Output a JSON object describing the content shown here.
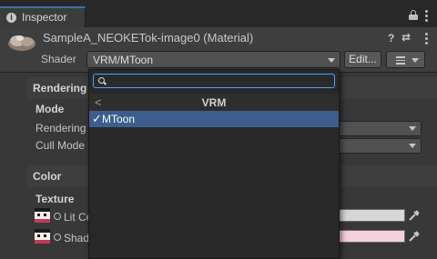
{
  "tab": {
    "icon": "info-icon",
    "label": "Inspector"
  },
  "header": {
    "title": "SampleA_NEOKETok-image0 (Material)",
    "help_icon": "?",
    "settings_icon": "⇄",
    "shader_label": "Shader",
    "shader_value": "VRM/MToon",
    "edit_label": "Edit...",
    "icons": [
      "lock-icon",
      "kebab-icon",
      "help-icon",
      "preset-icon",
      "list-icon"
    ]
  },
  "sections": {
    "rendering": "Rendering",
    "mode": "Mode",
    "rendering_row": "Rendering",
    "cull_mode_row": "Cull Mode",
    "color": "Color",
    "texture": "Texture",
    "lit_color": "Lit Co",
    "shade_color": "Shad"
  },
  "colors": {
    "lit_swatch": "#d6d6d6",
    "shade_swatch": "#f4cfdc",
    "selection": "#3d5d8f"
  },
  "popup": {
    "search_value": "",
    "back_icon": "<",
    "category": "VRM",
    "check": "✓",
    "item_label": "MToon"
  }
}
